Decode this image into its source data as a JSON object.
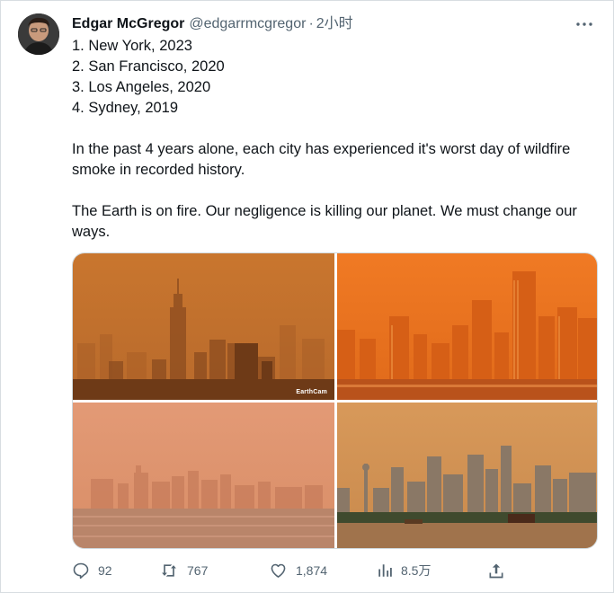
{
  "tweet": {
    "display_name": "Edgar McGregor",
    "handle": "@edgarrmcgregor",
    "separator": "·",
    "time": "2小时",
    "lines": [
      "1. New York, 2023",
      "2. San Francisco, 2020",
      "3. Los Angeles, 2020",
      "4. Sydney, 2019"
    ],
    "paragraph1": "In the past 4 years alone, each city has experienced it's worst day of wildfire smoke in recorded history.",
    "paragraph2": "The Earth is on fire. Our negligence is killing our planet. We must change our ways.",
    "image_watermark": "EarthCam"
  },
  "actions": {
    "replies": "92",
    "retweets": "767",
    "likes": "1,874",
    "views": "8.5万"
  },
  "colors": {
    "text": "#0f1419",
    "secondary": "#536471",
    "border": "#cfd9de"
  },
  "icons": [
    "more-icon",
    "reply-icon",
    "retweet-icon",
    "like-icon",
    "views-icon",
    "share-icon"
  ]
}
